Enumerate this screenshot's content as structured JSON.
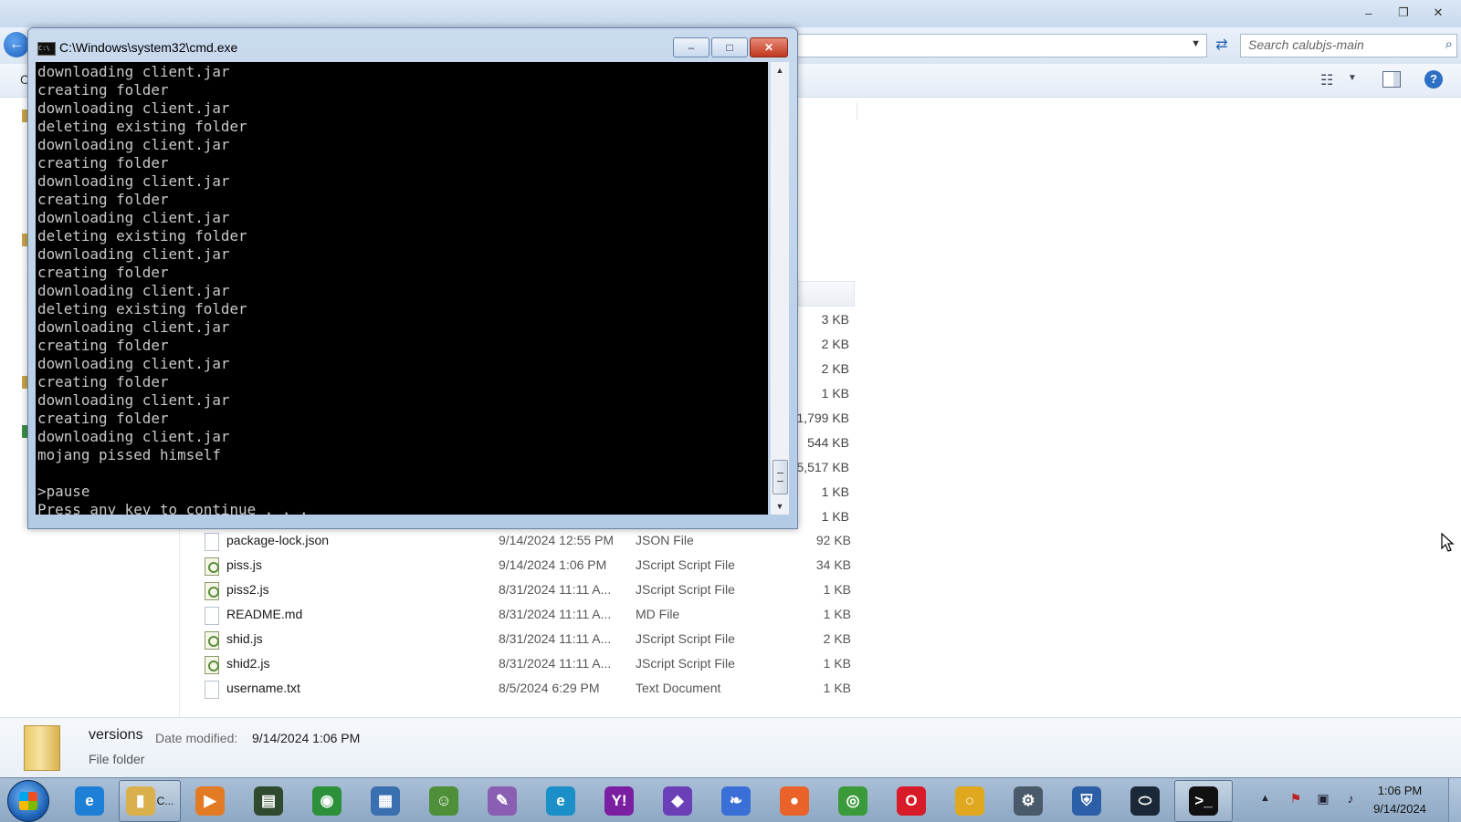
{
  "explorer": {
    "search_placeholder": "Search calubjs-main",
    "toolbar_label": "O",
    "files": [
      {
        "name": "package-lock.json",
        "date": "9/14/2024 12:55 PM",
        "type": "JSON File",
        "size": "92 KB",
        "icon": "json-file-icon"
      },
      {
        "name": "piss.js",
        "date": "9/14/2024 1:06 PM",
        "type": "JScript Script File",
        "size": "34 KB",
        "icon": "script-file-icon"
      },
      {
        "name": "piss2.js",
        "date": "8/31/2024 11:11 A...",
        "type": "JScript Script File",
        "size": "1 KB",
        "icon": "script-file-icon"
      },
      {
        "name": "README.md",
        "date": "8/31/2024 11:11 A...",
        "type": "MD File",
        "size": "1 KB",
        "icon": "md-file-icon"
      },
      {
        "name": "shid.js",
        "date": "8/31/2024 11:11 A...",
        "type": "JScript Script File",
        "size": "2 KB",
        "icon": "script-file-icon"
      },
      {
        "name": "shid2.js",
        "date": "8/31/2024 11:11 A...",
        "type": "JScript Script File",
        "size": "1 KB",
        "icon": "script-file-icon"
      },
      {
        "name": "username.txt",
        "date": "8/5/2024 6:29 PM",
        "type": "Text Document",
        "size": "1 KB",
        "icon": "text-file-icon"
      }
    ],
    "hidden_sizes": [
      "3 KB",
      "2 KB",
      "2 KB",
      "1 KB",
      "1,799 KB",
      "544 KB",
      "5,517 KB",
      "1 KB",
      "1 KB"
    ],
    "details": {
      "name": "versions",
      "date_label": "Date modified:",
      "date_value": "9/14/2024 1:06 PM",
      "kind": "File folder"
    }
  },
  "cmd": {
    "title": "C:\\Windows\\system32\\cmd.exe",
    "lines": [
      "downloading client.jar",
      "creating folder",
      "downloading client.jar",
      "deleting existing folder",
      "downloading client.jar",
      "creating folder",
      "downloading client.jar",
      "creating folder",
      "downloading client.jar",
      "deleting existing folder",
      "downloading client.jar",
      "creating folder",
      "downloading client.jar",
      "deleting existing folder",
      "downloading client.jar",
      "creating folder",
      "downloading client.jar",
      "creating folder",
      "downloading client.jar",
      "creating folder",
      "downloading client.jar",
      "mojang pissed himself",
      "",
      ">pause",
      "Press any key to continue . . ."
    ]
  },
  "taskbar": {
    "explorer_label": "C...",
    "clock_time": "1:06 PM",
    "clock_date": "9/14/2024",
    "items": [
      {
        "icon": "internet-explorer-icon",
        "color": "#1e7fd6"
      },
      {
        "icon": "file-explorer-icon",
        "color": "#d9b04c"
      },
      {
        "icon": "media-player-icon",
        "color": "#e37b24"
      },
      {
        "icon": "terminal-icon",
        "color": "#2f4a2f"
      },
      {
        "icon": "globe-icon",
        "color": "#2c8f3a"
      },
      {
        "icon": "toolbox-icon",
        "color": "#3a6fb0"
      },
      {
        "icon": "users-icon",
        "color": "#4f8f3a"
      },
      {
        "icon": "paint-icon",
        "color": "#8a5fb3"
      },
      {
        "icon": "edge-icon",
        "color": "#1a8fc8"
      },
      {
        "icon": "yahoo-messenger-icon",
        "color": "#7b1fa2"
      },
      {
        "icon": "visual-studio-icon",
        "color": "#6a3fb8"
      },
      {
        "icon": "feather-icon",
        "color": "#3a6fd8"
      },
      {
        "icon": "firefox-icon",
        "color": "#e8622a"
      },
      {
        "icon": "chrome-icon",
        "color": "#3a9a3a"
      },
      {
        "icon": "opera-icon",
        "color": "#d81b28"
      },
      {
        "icon": "ring-icon",
        "color": "#e0a81e"
      },
      {
        "icon": "network-tool-icon",
        "color": "#4a5a6a"
      },
      {
        "icon": "security-shield-icon",
        "color": "#2d5fa8"
      },
      {
        "icon": "steam-icon",
        "color": "#1b2838"
      },
      {
        "icon": "cmd-icon",
        "color": "#111111"
      }
    ]
  }
}
